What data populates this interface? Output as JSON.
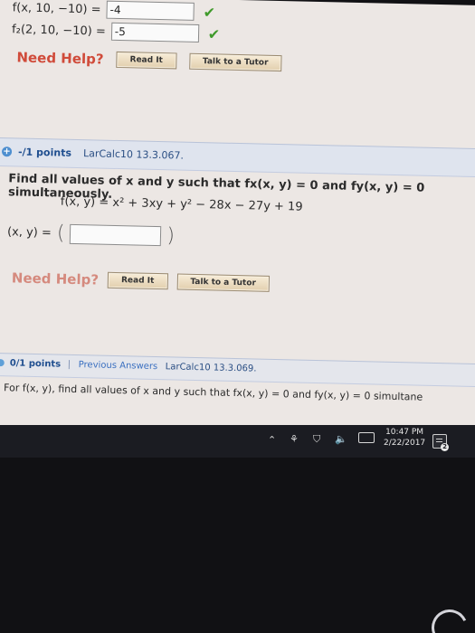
{
  "prev_question": {
    "row1": {
      "label": "f(x, 10, −10) =",
      "value": "-4"
    },
    "row2": {
      "label": "f₂(2, 10, −10) =",
      "value": "-5"
    },
    "help_label": "Need Help?",
    "read_it": "Read It",
    "talk_to_tutor": "Talk to a Tutor"
  },
  "question": {
    "points": "-/1 points",
    "id": "LarCalc10 13.3.067.",
    "prompt": "Find all values of x and y such that fx(x, y) = 0 and fy(x, y) = 0 simultaneously.",
    "function": "f(x, y) = x² + 3xy + y² − 28x − 27y + 19",
    "answer_label": "(x, y) =",
    "answer_open": "(",
    "answer_value": "",
    "answer_close": ")",
    "help_label": "Need Help?",
    "read_it": "Read It",
    "talk_to_tutor": "Talk to a Tutor"
  },
  "next_question": {
    "points": "0/1 points",
    "separator": "|",
    "previous_answers": "Previous Answers",
    "id": "LarCalc10 13.3.069.",
    "prompt": "For f(x, y), find all values of x and y such that fx(x, y) = 0 and fy(x, y) = 0 simultane"
  },
  "taskbar": {
    "time": "10:47 PM",
    "date": "2/22/2017",
    "notification_count": "2",
    "icons": [
      "chevron-up-icon",
      "people-icon",
      "shield-icon",
      "speaker-icon",
      "keyboard-icon",
      "notifications-icon"
    ]
  },
  "colors": {
    "page_bg": "#ece7e4",
    "header_bg": "#dfe4ee",
    "help_red": "#d04b3a",
    "check_green": "#3f9a2a",
    "taskbar_bg": "#1b1c22"
  }
}
